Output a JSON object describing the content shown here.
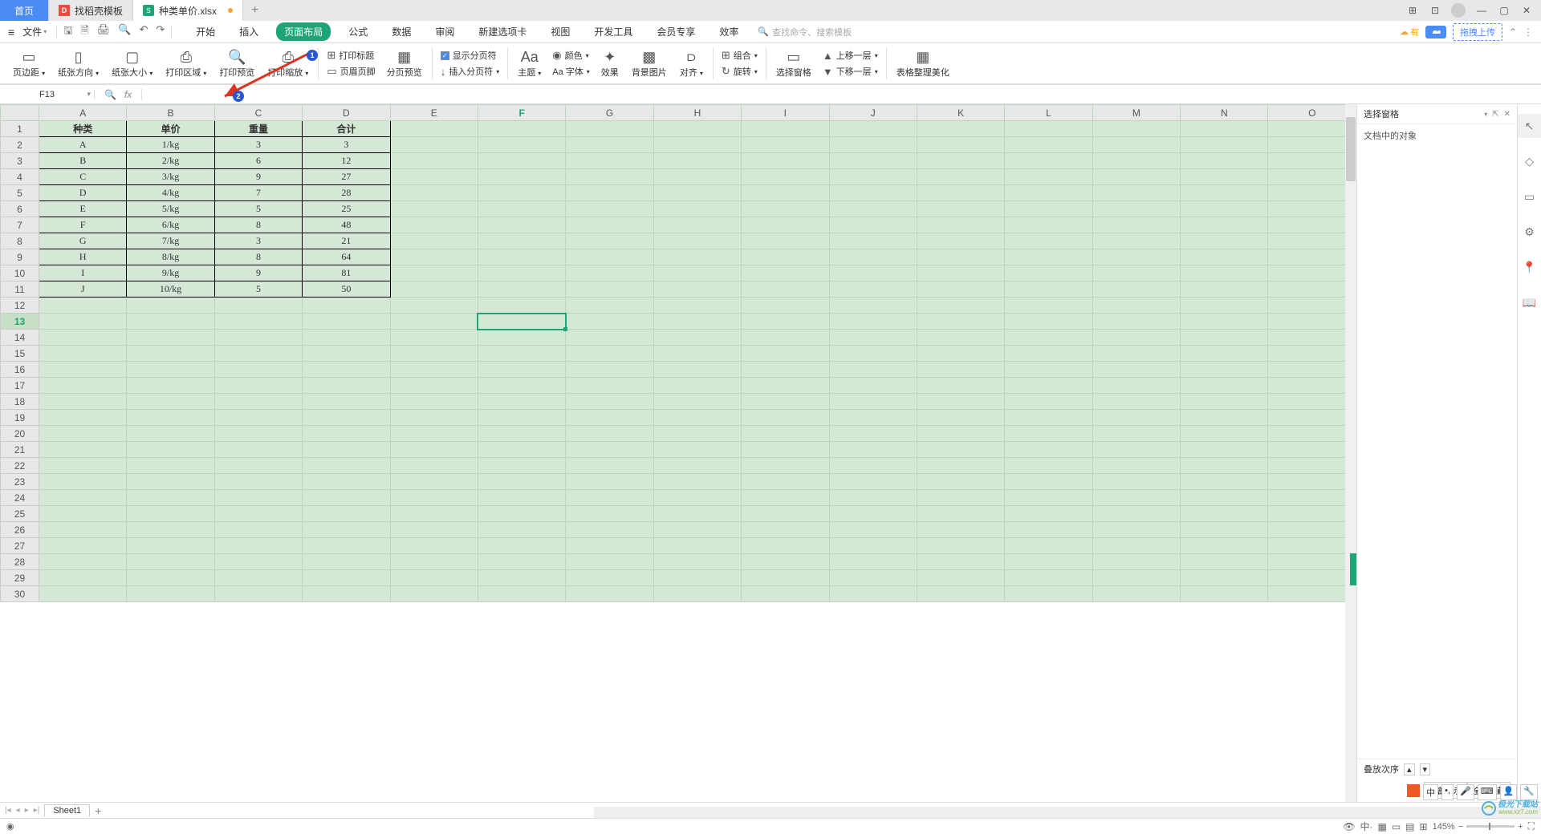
{
  "titlebar": {
    "home_tab": "首页",
    "templates_tab": "找稻壳模板",
    "file_tab": "种类单价.xlsx"
  },
  "menubar": {
    "file_label": "文件",
    "tabs": [
      "开始",
      "插入",
      "页面布局",
      "公式",
      "数据",
      "审阅",
      "新建选项卡",
      "视图",
      "开发工具",
      "会员专享",
      "效率"
    ],
    "active_tab_index": 2,
    "search_placeholder": "查找命令、搜索模板",
    "cloud_status_prefix": "有",
    "upload_label": "拖拽上传"
  },
  "ribbon": {
    "items": [
      {
        "label": "页边距",
        "dd": true,
        "icon": "▭"
      },
      {
        "label": "纸张方向",
        "dd": true,
        "icon": "▯"
      },
      {
        "label": "纸张大小",
        "dd": true,
        "icon": "▢"
      },
      {
        "label": "打印区域",
        "dd": true,
        "icon": "⎙"
      },
      {
        "label": "打印预览",
        "icon": "🔍"
      },
      {
        "label": "打印缩放",
        "dd": true,
        "icon": "⎙"
      }
    ],
    "stack1": {
      "print_titles": "打印标题",
      "page_header": "页眉页脚"
    },
    "items2": [
      {
        "label": "分页预览",
        "icon": "▦"
      }
    ],
    "stack2": {
      "show_breaks": "显示分页符",
      "insert_break": "插入分页符"
    },
    "items3": [
      {
        "label": "主题",
        "dd": true,
        "icon": "Aa"
      }
    ],
    "stack3": {
      "color": "颜色",
      "font": "Aa 字体"
    },
    "items4": [
      {
        "label": "效果",
        "icon": "✦"
      },
      {
        "label": "背景图片",
        "icon": "▩"
      },
      {
        "label": "对齐",
        "dd": true,
        "icon": "⫐"
      }
    ],
    "stack4": {
      "group": "组合",
      "rotate": "旋转"
    },
    "items5": [
      {
        "label": "选择窗格",
        "icon": "▭"
      }
    ],
    "stack5": {
      "up": "上移一层",
      "down": "下移一层"
    },
    "items6": [
      {
        "label": "表格整理美化",
        "icon": "▦"
      }
    ]
  },
  "formula": {
    "name_box": "F13",
    "fx_label": "fx"
  },
  "columns": [
    "A",
    "B",
    "C",
    "D",
    "E",
    "F",
    "G",
    "H",
    "I",
    "J",
    "K",
    "L",
    "M",
    "N",
    "O"
  ],
  "active_col": "F",
  "active_row": 13,
  "headers": [
    "种类",
    "单价",
    "重量",
    "合计"
  ],
  "table": [
    {
      "a": "A",
      "b": "1/kg",
      "c": "3",
      "d": "3"
    },
    {
      "a": "B",
      "b": "2/kg",
      "c": "6",
      "d": "12"
    },
    {
      "a": "C",
      "b": "3/kg",
      "c": "9",
      "d": "27"
    },
    {
      "a": "D",
      "b": "4/kg",
      "c": "7",
      "d": "28"
    },
    {
      "a": "E",
      "b": "5/kg",
      "c": "5",
      "d": "25"
    },
    {
      "a": "F",
      "b": "6/kg",
      "c": "8",
      "d": "48"
    },
    {
      "a": "G",
      "b": "7/kg",
      "c": "3",
      "d": "21"
    },
    {
      "a": "H",
      "b": "8/kg",
      "c": "8",
      "d": "64"
    },
    {
      "a": "I",
      "b": "9/kg",
      "c": "9",
      "d": "81"
    },
    {
      "a": "J",
      "b": "10/kg",
      "c": "5",
      "d": "50"
    }
  ],
  "right_panel": {
    "title": "选择窗格",
    "subtitle": "文档中的对象",
    "stack_label": "叠放次序",
    "show_all": "全部显示",
    "hide_all": "全部隐藏"
  },
  "sheet_tabs": {
    "tab1": "Sheet1"
  },
  "statusbar": {
    "zoom": "145%"
  },
  "annotations": {
    "badge1": "1",
    "badge2": "2"
  },
  "watermark": {
    "line1": "极光下载站",
    "line2": "www.xz7.com"
  },
  "ime": {
    "lang": "中"
  }
}
